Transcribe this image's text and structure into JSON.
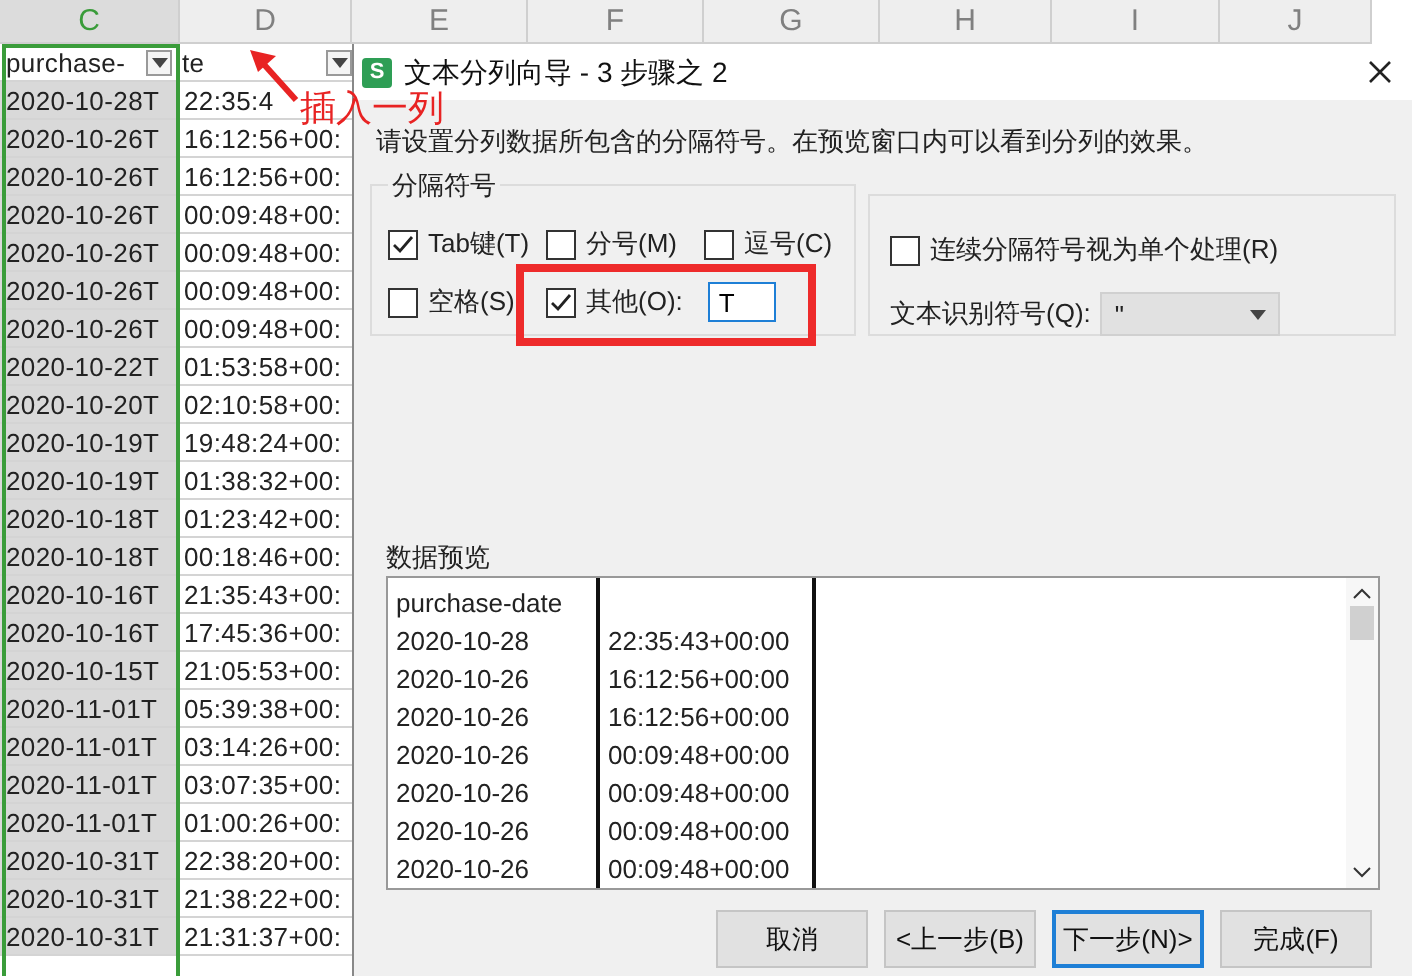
{
  "sheet": {
    "columns": [
      {
        "label": "C",
        "selected": true
      },
      {
        "label": "D",
        "selected": false
      },
      {
        "label": "E",
        "selected": false
      },
      {
        "label": "F",
        "selected": false
      },
      {
        "label": "G",
        "selected": false
      },
      {
        "label": "H",
        "selected": false
      },
      {
        "label": "I",
        "selected": false
      },
      {
        "label": "J",
        "selected": false
      }
    ],
    "header_cell": {
      "before_filter": "purchase-",
      "after_filter": "te"
    },
    "rows": [
      [
        "2020-10-28T",
        "22:35:4"
      ],
      [
        "2020-10-26T",
        "16:12:56+00:"
      ],
      [
        "2020-10-26T",
        "16:12:56+00:"
      ],
      [
        "2020-10-26T",
        "00:09:48+00:"
      ],
      [
        "2020-10-26T",
        "00:09:48+00:"
      ],
      [
        "2020-10-26T",
        "00:09:48+00:"
      ],
      [
        "2020-10-26T",
        "00:09:48+00:"
      ],
      [
        "2020-10-22T",
        "01:53:58+00:"
      ],
      [
        "2020-10-20T",
        "02:10:58+00:"
      ],
      [
        "2020-10-19T",
        "19:48:24+00:"
      ],
      [
        "2020-10-19T",
        "01:38:32+00:"
      ],
      [
        "2020-10-18T",
        "01:23:42+00:"
      ],
      [
        "2020-10-18T",
        "00:18:46+00:"
      ],
      [
        "2020-10-16T",
        "21:35:43+00:"
      ],
      [
        "2020-10-16T",
        "17:45:36+00:"
      ],
      [
        "2020-10-15T",
        "21:05:53+00:"
      ],
      [
        "2020-11-01T",
        "05:39:38+00:"
      ],
      [
        "2020-11-01T",
        "03:14:26+00:"
      ],
      [
        "2020-11-01T",
        "03:07:35+00:"
      ],
      [
        "2020-11-01T",
        "01:00:26+00:"
      ],
      [
        "2020-10-31T",
        "22:38:20+00:"
      ],
      [
        "2020-10-31T",
        "21:38:22+00:"
      ],
      [
        "2020-10-31T",
        "21:31:37+00:"
      ]
    ]
  },
  "annotation": {
    "text": "插入一列"
  },
  "dialog": {
    "icon_letter": "S",
    "title": "文本分列向导 - 3 步骤之 2",
    "instruction": "请设置分列数据所包含的分隔符号。在预览窗口内可以看到分列的效果。",
    "delimiters": {
      "title": "分隔符号",
      "options": [
        {
          "kind": "checkbox",
          "label": "Tab键(T)",
          "checked": true
        },
        {
          "kind": "checkbox",
          "label": "分号(M)",
          "checked": false
        },
        {
          "kind": "checkbox",
          "label": "逗号(C)",
          "checked": false
        },
        {
          "kind": "checkbox",
          "label": "空格(S)",
          "checked": false
        },
        {
          "kind": "other",
          "label": "其他(O):",
          "checked": true,
          "value": "T",
          "highlighted": true
        }
      ]
    },
    "consecutive": {
      "label": "连续分隔符号视为单个处理(R)",
      "checked": false
    },
    "qualifier": {
      "label": "文本识别符号(Q):",
      "value": "\""
    },
    "preview": {
      "title": "数据预览",
      "rows": [
        [
          "purchase-date",
          ""
        ],
        [
          "2020-10-28",
          "22:35:43+00:00"
        ],
        [
          "2020-10-26",
          "16:12:56+00:00"
        ],
        [
          "2020-10-26",
          "16:12:56+00:00"
        ],
        [
          "2020-10-26",
          "00:09:48+00:00"
        ],
        [
          "2020-10-26",
          "00:09:48+00:00"
        ],
        [
          "2020-10-26",
          "00:09:48+00:00"
        ],
        [
          "2020-10-26",
          "00:09:48+00:00"
        ]
      ]
    },
    "buttons": [
      {
        "label": "取消",
        "focused": false
      },
      {
        "label": "<上一步(B)",
        "focused": false
      },
      {
        "label": "下一步(N)>",
        "focused": true
      },
      {
        "label": "完成(F)",
        "focused": false
      }
    ]
  }
}
